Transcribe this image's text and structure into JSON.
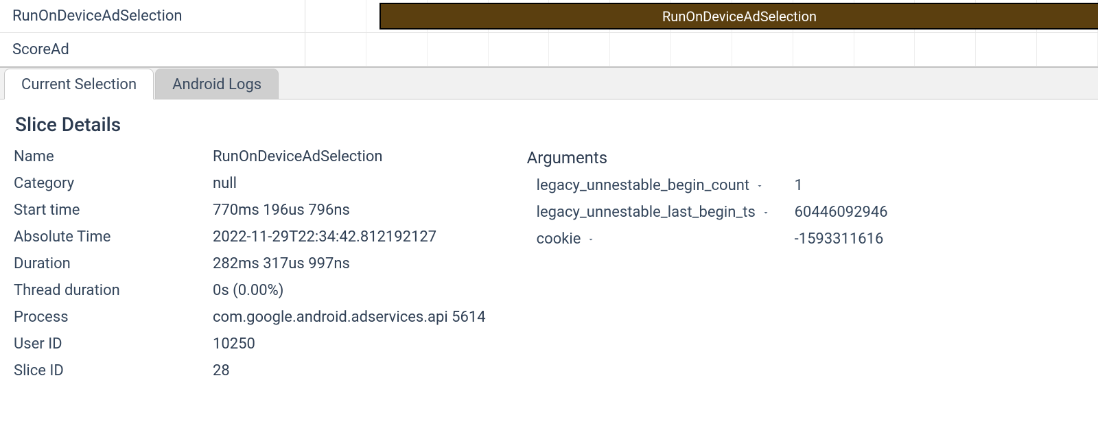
{
  "trace": {
    "rows": [
      {
        "label": "RunOnDeviceAdSelection",
        "slice_label": "RunOnDeviceAdSelection",
        "has_slice": true
      },
      {
        "label": "ScoreAd",
        "slice_label": "",
        "has_slice": false
      }
    ],
    "grid_divisions": 13
  },
  "tabs": [
    {
      "label": "Current Selection",
      "active": true
    },
    {
      "label": "Android Logs",
      "active": false
    }
  ],
  "details": {
    "title": "Slice Details",
    "fields": [
      {
        "label": "Name",
        "value": "RunOnDeviceAdSelection"
      },
      {
        "label": "Category",
        "value": "null"
      },
      {
        "label": "Start time",
        "value": "770ms 196us 796ns"
      },
      {
        "label": "Absolute Time",
        "value": "2022-11-29T22:34:42.812192127"
      },
      {
        "label": "Duration",
        "value": "282ms 317us 997ns"
      },
      {
        "label": "Thread duration",
        "value": "0s (0.00%)"
      },
      {
        "label": "Process",
        "value": "com.google.android.adservices.api 5614"
      },
      {
        "label": "User ID",
        "value": "10250"
      },
      {
        "label": "Slice ID",
        "value": "28"
      }
    ],
    "arguments_title": "Arguments",
    "arguments": [
      {
        "key": "legacy_unnestable_begin_count",
        "value": "1"
      },
      {
        "key": "legacy_unnestable_last_begin_ts",
        "value": "60446092946"
      },
      {
        "key": "cookie",
        "value": "-1593311616"
      }
    ]
  }
}
